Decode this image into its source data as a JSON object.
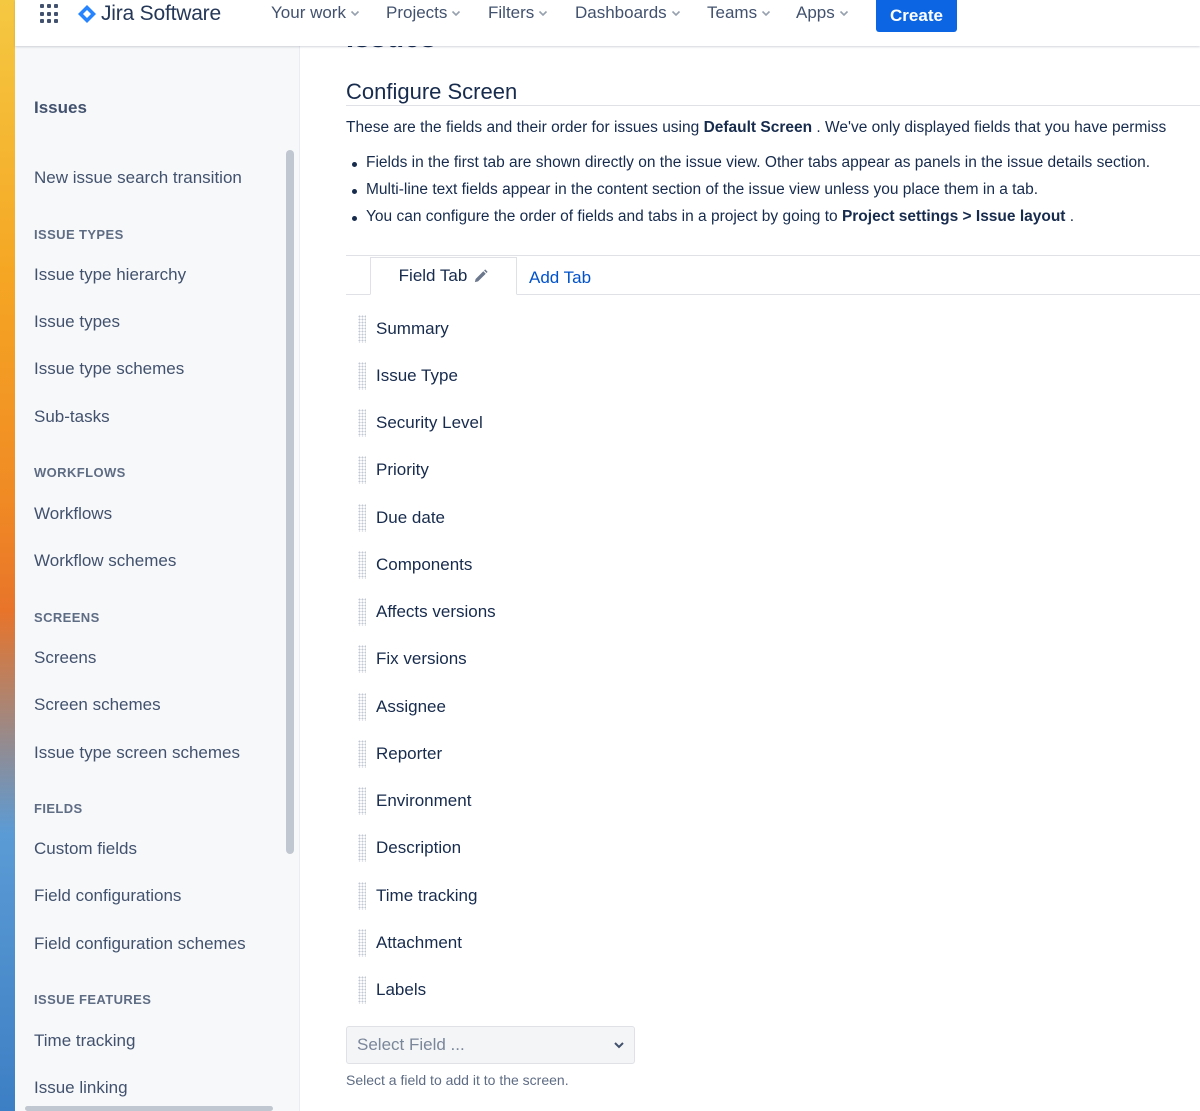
{
  "topnav": {
    "product_name": "Jira Software",
    "items": [
      {
        "label": "Your work"
      },
      {
        "label": "Projects"
      },
      {
        "label": "Filters"
      },
      {
        "label": "Dashboards"
      },
      {
        "label": "Teams"
      },
      {
        "label": "Apps"
      }
    ],
    "create_label": "Create"
  },
  "sidebar": {
    "title": "Issues",
    "top_link": "New issue search transition",
    "sections": [
      {
        "heading": "ISSUE TYPES",
        "items": [
          "Issue type hierarchy",
          "Issue types",
          "Issue type schemes",
          "Sub-tasks"
        ]
      },
      {
        "heading": "WORKFLOWS",
        "items": [
          "Workflows",
          "Workflow schemes"
        ]
      },
      {
        "heading": "SCREENS",
        "items": [
          "Screens",
          "Screen schemes",
          "Issue type screen schemes"
        ]
      },
      {
        "heading": "FIELDS",
        "items": [
          "Custom fields",
          "Field configurations",
          "Field configuration schemes"
        ]
      },
      {
        "heading": "ISSUE FEATURES",
        "items": [
          "Time tracking",
          "Issue linking"
        ]
      }
    ]
  },
  "main": {
    "cut_heading": "Issues",
    "title": "Configure Screen",
    "desc_prefix": "These are the fields and their order for issues using ",
    "desc_screen": "Default Screen",
    "desc_suffix": " . We've only displayed fields that you have permiss",
    "bullets": [
      {
        "text": "Fields in the first tab are shown directly on the issue view. Other tabs appear as panels in the issue details section."
      },
      {
        "text": "Multi-line text fields appear in the content section of the issue view unless you place them in a tab."
      },
      {
        "text": "You can configure the order of fields and tabs in a project by going to ",
        "bold": "Project settings > Issue layout",
        "after": " ."
      }
    ],
    "tabs": {
      "active_label": "Field Tab",
      "add_label": "Add Tab"
    },
    "fields": [
      "Summary",
      "Issue Type",
      "Security Level",
      "Priority",
      "Due date",
      "Components",
      "Affects versions",
      "Fix versions",
      "Assignee",
      "Reporter",
      "Environment",
      "Description",
      "Time tracking",
      "Attachment",
      "Labels"
    ],
    "select_placeholder": "Select Field ...",
    "select_help": "Select a field to add it to the screen."
  },
  "colors": {
    "accent": "#0c66e4",
    "link": "#0052cc",
    "text": "#172b4d",
    "subtle_text": "#42526e",
    "sidebar_bg": "#f7f8f9"
  },
  "icons": [
    "app-switcher-icon",
    "jira-logo-icon",
    "chevron-down-icon",
    "pencil-icon",
    "drag-handle-icon"
  ]
}
